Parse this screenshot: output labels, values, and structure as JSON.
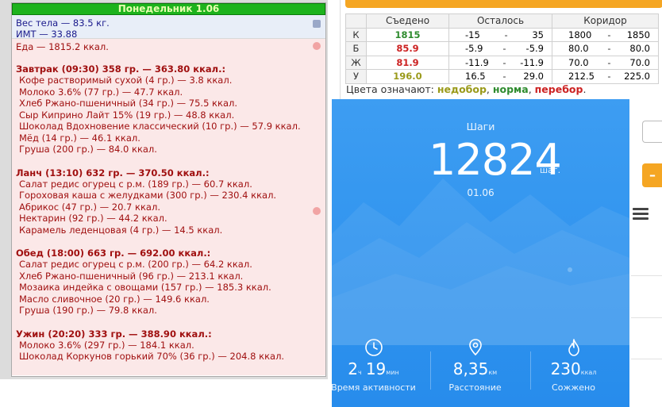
{
  "diary": {
    "day_header": "Понедельник 1.06",
    "weight": "Вес тела — 83.5 кг.",
    "bmi": "ИМТ — 33.88",
    "food_total": "Еда — 1815.2 ккал.",
    "meals": [
      {
        "title": "Завтрак (09:30) 358 гр. — 363.80 ккал.:",
        "items": [
          "Кофе растворимый сухой (4 гр.) — 3.8 ккал.",
          "Молоко 3.6% (77 гр.) — 47.7 ккал.",
          "Хлеб Ржано-пшеничный (34 гр.) — 75.5 ккал.",
          "Сыр Киприно Лайт 15% (19 гр.) — 48.8 ккал.",
          "Шоколад Вдохновение классический (10 гр.) — 57.9 ккал.",
          "Мёд (14 гр.) — 46.1 ккал.",
          "Груша (200 гр.) — 84.0 ккал."
        ]
      },
      {
        "title": "Ланч (13:10) 632 гр. — 370.50 ккал.:",
        "items": [
          "Салат редис огурец с р.м. (189 гр.) — 60.7 ккал.",
          "Гороховая каша с желудками (300 гр.) — 230.4 ккал.",
          "Абрикос (47 гр.) — 20.7 ккал.",
          "Нектарин (92 гр.) — 44.2 ккал.",
          "Карамель леденцовая (4 гр.) — 14.5 ккал."
        ]
      },
      {
        "title": "Обед (18:00) 663 гр. — 692.00 ккал.:",
        "items": [
          "Салат редис огурец с р.м. (200 гр.) — 64.2 ккал.",
          "Хлеб Ржано-пшеничный (96 гр.) — 213.1 ккал.",
          "Мозаика индейка с овощами (157 гр.) — 185.3 ккал.",
          "Масло сливочное (20 гр.) — 149.6 ккал.",
          "Груша (190 гр.) — 79.8 ккал."
        ]
      },
      {
        "title": "Ужин (20:20) 333 гр. — 388.90 ккал.:",
        "items": [
          "Молоко 3.6% (297 гр.) — 184.1 ккал.",
          "Шоколад Коркунов горький 70% (36 гр.) — 204.8 ккал."
        ]
      }
    ]
  },
  "stats": {
    "headers": [
      "Съедено",
      "Осталось",
      "Коридор"
    ],
    "rows": [
      {
        "label": "К",
        "eaten": "1815",
        "eaten_color": "#2e8b2e",
        "rem_a": "-15",
        "rem_b": "35",
        "cor_a": "1800",
        "cor_b": "1850"
      },
      {
        "label": "Б",
        "eaten": "85.9",
        "eaten_color": "#cc2222",
        "rem_a": "-5.9",
        "rem_b": "-5.9",
        "cor_a": "80.0",
        "cor_b": "80.0"
      },
      {
        "label": "Ж",
        "eaten": "81.9",
        "eaten_color": "#cc2222",
        "rem_a": "-11.9",
        "rem_b": "-11.9",
        "cor_a": "70.0",
        "cor_b": "70.0"
      },
      {
        "label": "У",
        "eaten": "196.0",
        "eaten_color": "#9a9a1a",
        "rem_a": "16.5",
        "rem_b": "29.0",
        "cor_a": "212.5",
        "cor_b": "225.0"
      }
    ],
    "dash": "-",
    "legend_prefix": "Цвета означают:",
    "legend_under": "недобор",
    "legend_under_color": "#9a9a1a",
    "legend_norm": "норма",
    "legend_norm_color": "#2e8b2e",
    "legend_over": "перебор",
    "legend_over_color": "#cc2222",
    "minus_button": "–"
  },
  "steps": {
    "title": "Шаги",
    "value": "12824",
    "unit": "шаг.",
    "date": "01.06",
    "metrics": [
      {
        "icon": "clock-icon",
        "hours": "2",
        "hours_unit": "ч",
        "minutes": "19",
        "minutes_unit": "мин",
        "caption": "Время активности"
      },
      {
        "icon": "location-pin-icon",
        "value": "8,35",
        "unit": "км",
        "caption": "Расстояние"
      },
      {
        "icon": "flame-icon",
        "value": "230",
        "unit": "ккал",
        "caption": "Сожжено"
      }
    ]
  }
}
